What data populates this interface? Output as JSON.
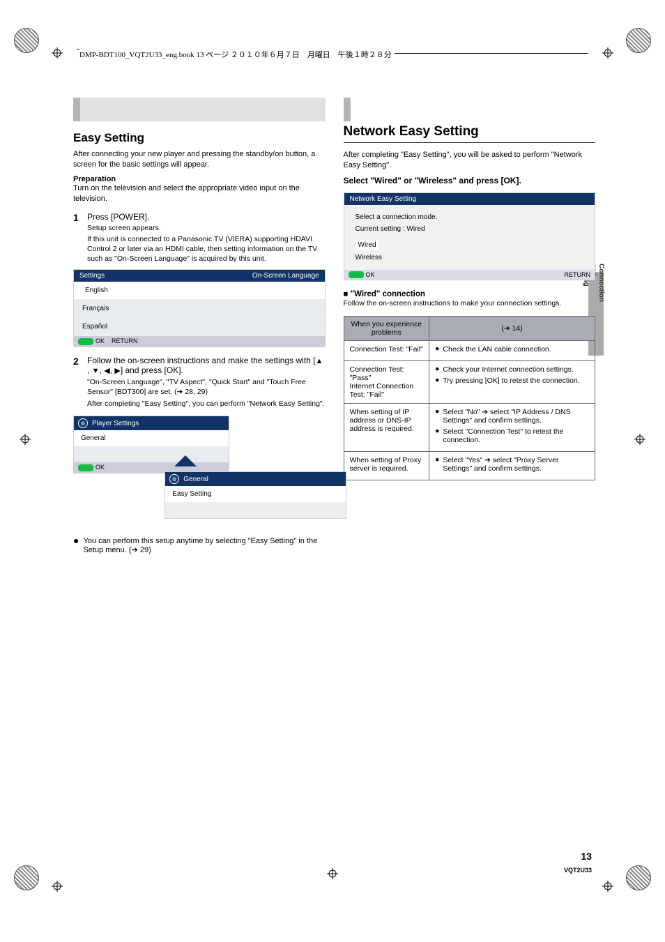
{
  "header_text": "DMP-BDT100_VQT2U33_eng.book  13 ページ  ２０１０年６月７日　月曜日　午後１時２８分",
  "left": {
    "title": "Easy Setting",
    "intro": "After connecting your new player and pressing the standby/on button, a screen for the basic settings will appear.",
    "prep_label": "Preparation",
    "prep_text": "Turn on the television and select the appropriate video input on the television.",
    "step1_no": "1",
    "step1_text": "Press [POWER].",
    "step1_sub": "Setup screen appears.",
    "step1_sub2": "If this unit is connected to a Panasonic TV (VIERA) supporting HDAVI Control 2 or later via an HDMI cable, then setting information on the TV such as \"On-Screen Language\" is acquired by this unit.",
    "step2_no": "2",
    "step2_text": "Follow the on-screen instructions and make the settings with [▲, ▼, ◀, ▶] and press [OK].",
    "step2_sub": "\"On-Screen Language\", \"TV Aspect\", \"Quick Start\" and \"Touch Free Sensor\" [BDT300] are set. (➔ 28, 29)",
    "step2_sub2": "After completing \"Easy Setting\", you can perform \"Network Easy Setting\".",
    "note": "You can perform this setup anytime by selecting \"Easy Setting\" in the Setup menu. (➔ 29)",
    "settings_box": {
      "title_left": "Settings",
      "title_right": "On-Screen Language",
      "items": [
        "English",
        "Français",
        "Español"
      ],
      "footer_left": "OK",
      "footer_right": "RETURN"
    },
    "submenu": {
      "title": "Player Settings",
      "item_selected": "General",
      "sub_item": "General",
      "sub_opts": [
        "Easy Setting"
      ]
    }
  },
  "right": {
    "title": "Network Easy Setting",
    "intro": "After completing \"Easy Setting\", you will be asked to perform \"Network Easy Setting\".",
    "instruction": "Select \"Wired\" or \"Wireless\" and press [OK].",
    "box": {
      "title": "Network Easy Setting",
      "line1": "Select a connection mode.",
      "line2": "Current setting : Wired",
      "opt_sel": "Wired",
      "opt2": "Wireless",
      "footer_ok": "OK",
      "footer_ret": "RETURN"
    },
    "sub_title": "■ \"Wired\" connection",
    "sub_text": "Follow the on-screen instructions to make your connection settings.",
    "table_title": "When you experience problems",
    "table": {
      "head": [
        "",
        "(➔ 14)"
      ],
      "rows": [
        {
          "l": "Connection Test: \"Fail\"",
          "r": [
            "Check the LAN cable connection."
          ]
        },
        {
          "l": "Connection Test: \"Pass\"\nInternet Connection Test: \"Fail\"",
          "r": [
            "Check your Internet connection settings.",
            "Try pressing [OK] to retest the connection."
          ]
        },
        {
          "l": "When setting of IP address or DNS-IP address is required.",
          "r": [
            "Select \"No\" ➔ select \"IP Address / DNS Settings\" and confirm settings.",
            "Select \"Connection Test\" to retest the connection."
          ]
        },
        {
          "l": "When setting of Proxy server is required.",
          "r": [
            "Select \"Yes\" ➔ select \"Proxy Server Settings\" and confirm settings."
          ]
        }
      ]
    }
  },
  "sidebar_label": "Connection and setting",
  "page_number": "13",
  "vqt": "VQT2U33"
}
